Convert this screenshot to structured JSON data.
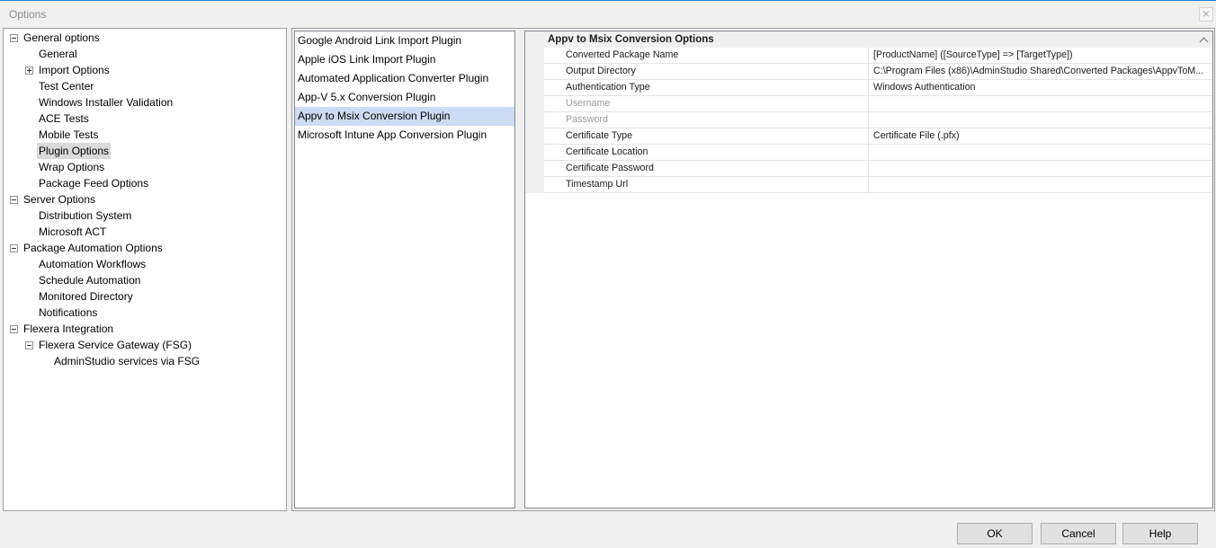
{
  "window": {
    "title": "Options",
    "close_icon": "close-icon"
  },
  "tree": {
    "groups": [
      {
        "label": "General options",
        "expander_icon": "collapse-icon",
        "children": [
          {
            "label": "General"
          },
          {
            "label": "Import Options",
            "expander_icon": "expand-icon"
          },
          {
            "label": "Test Center"
          },
          {
            "label": "Windows Installer Validation"
          },
          {
            "label": "ACE Tests"
          },
          {
            "label": "Mobile Tests"
          },
          {
            "label": "Plugin Options",
            "selected": true
          },
          {
            "label": "Wrap Options"
          },
          {
            "label": "Package Feed Options"
          }
        ]
      },
      {
        "label": "Server Options",
        "expander_icon": "collapse-icon",
        "children": [
          {
            "label": "Distribution System"
          },
          {
            "label": "Microsoft ACT"
          }
        ]
      },
      {
        "label": "Package Automation Options",
        "expander_icon": "collapse-icon",
        "children": [
          {
            "label": "Automation Workflows"
          },
          {
            "label": "Schedule Automation"
          },
          {
            "label": "Monitored Directory"
          },
          {
            "label": "Notifications"
          }
        ]
      },
      {
        "label": "Flexera Integration",
        "expander_icon": "collapse-icon",
        "children": [
          {
            "label": "Flexera Service Gateway (FSG)",
            "expander_icon": "collapse-icon",
            "children": [
              {
                "label": "AdminStudio services via FSG"
              }
            ]
          }
        ]
      }
    ]
  },
  "plugins": {
    "items": [
      {
        "label": "Google Android Link Import Plugin"
      },
      {
        "label": "Apple iOS Link Import Plugin"
      },
      {
        "label": "Automated Application Converter Plugin"
      },
      {
        "label": "App-V 5.x Conversion Plugin"
      },
      {
        "label": "Appv to Msix Conversion Plugin",
        "selected": true
      },
      {
        "label": "Microsoft Intune App Conversion Plugin"
      }
    ]
  },
  "property_grid": {
    "category": "Appv to Msix Conversion Options",
    "category_icon": "chevron-up-icon",
    "rows": [
      {
        "name": "Converted Package Name",
        "value": "[ProductName] ([SourceType] => [TargetType])",
        "enabled": true
      },
      {
        "name": "Output Directory",
        "value": "C:\\Program Files (x86)\\AdminStudio Shared\\Converted Packages\\AppvToM...",
        "enabled": true
      },
      {
        "name": "Authentication Type",
        "value": "Windows Authentication",
        "enabled": true
      },
      {
        "name": "Username",
        "value": "",
        "enabled": false
      },
      {
        "name": "Password",
        "value": "",
        "enabled": false
      },
      {
        "name": "Certificate Type",
        "value": "Certificate File (.pfx)",
        "enabled": true
      },
      {
        "name": "Certificate Location",
        "value": "",
        "enabled": true
      },
      {
        "name": "Certificate Password",
        "value": "",
        "enabled": true
      },
      {
        "name": "Timestamp Url",
        "value": "",
        "enabled": true
      }
    ]
  },
  "buttons": {
    "ok": "OK",
    "cancel": "Cancel",
    "help": "Help"
  },
  "colors": {
    "accent": "#2b7bd4",
    "list_selection": "#cddbf4",
    "tree_selection": "#dadada",
    "disabled_text": "#9a9a9a"
  }
}
